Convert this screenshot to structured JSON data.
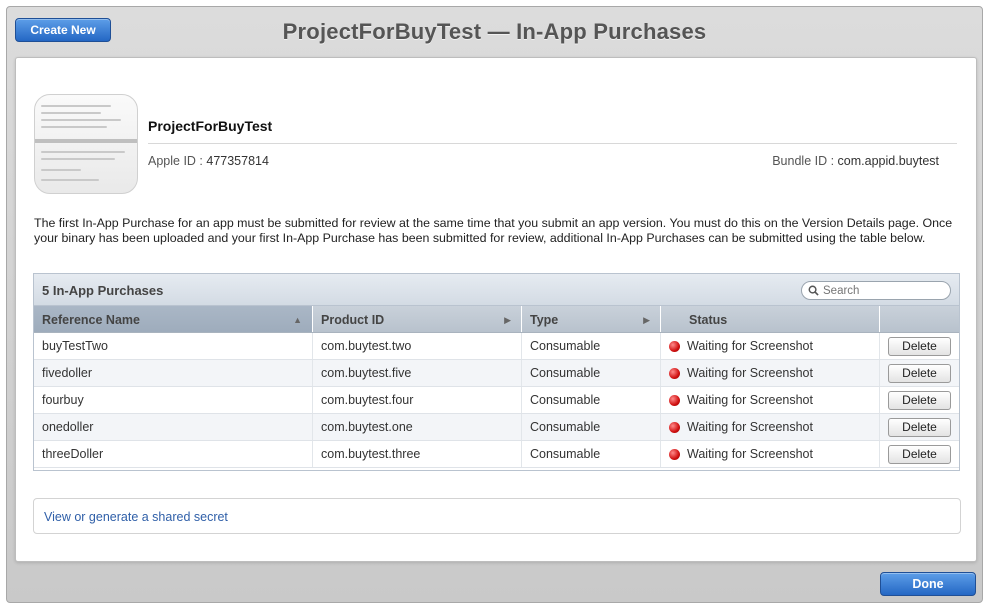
{
  "header": {
    "create_label": "Create New",
    "title": "ProjectForBuyTest — In-App Purchases"
  },
  "app": {
    "name": "ProjectForBuyTest",
    "apple_id_label": "Apple ID :",
    "apple_id": "477357814",
    "bundle_id_label": "Bundle ID :",
    "bundle_id": "com.appid.buytest"
  },
  "notice": "The first In-App Purchase for an app must be submitted for review at the same time that you submit an app version. You must do this on the Version Details page. Once your binary has been uploaded and your first In-App Purchase has been submitted for review, additional In-App Purchases can be submitted using the table below.",
  "table": {
    "count_label": "5 In-App Purchases",
    "search_placeholder": "Search",
    "columns": [
      "Reference Name",
      "Product ID",
      "Type",
      "Status",
      ""
    ],
    "rows": [
      {
        "name": "buyTestTwo",
        "product_id": "com.buytest.two",
        "type": "Consumable",
        "status": "Waiting for Screenshot",
        "action": "Delete"
      },
      {
        "name": "fivedoller",
        "product_id": "com.buytest.five",
        "type": "Consumable",
        "status": "Waiting for Screenshot",
        "action": "Delete"
      },
      {
        "name": "fourbuy",
        "product_id": "com.buytest.four",
        "type": "Consumable",
        "status": "Waiting for Screenshot",
        "action": "Delete"
      },
      {
        "name": "onedoller",
        "product_id": "com.buytest.one",
        "type": "Consumable",
        "status": "Waiting for Screenshot",
        "action": "Delete"
      },
      {
        "name": "threeDoller",
        "product_id": "com.buytest.three",
        "type": "Consumable",
        "status": "Waiting for Screenshot",
        "action": "Delete"
      }
    ],
    "status_color": "#d01010"
  },
  "secret_link": "View or generate a shared secret",
  "footer": {
    "done_label": "Done"
  },
  "icons": {
    "sort_ascending": "triangle-up-icon",
    "column_arrow": "triangle-right-icon",
    "search": "magnifier-icon"
  }
}
